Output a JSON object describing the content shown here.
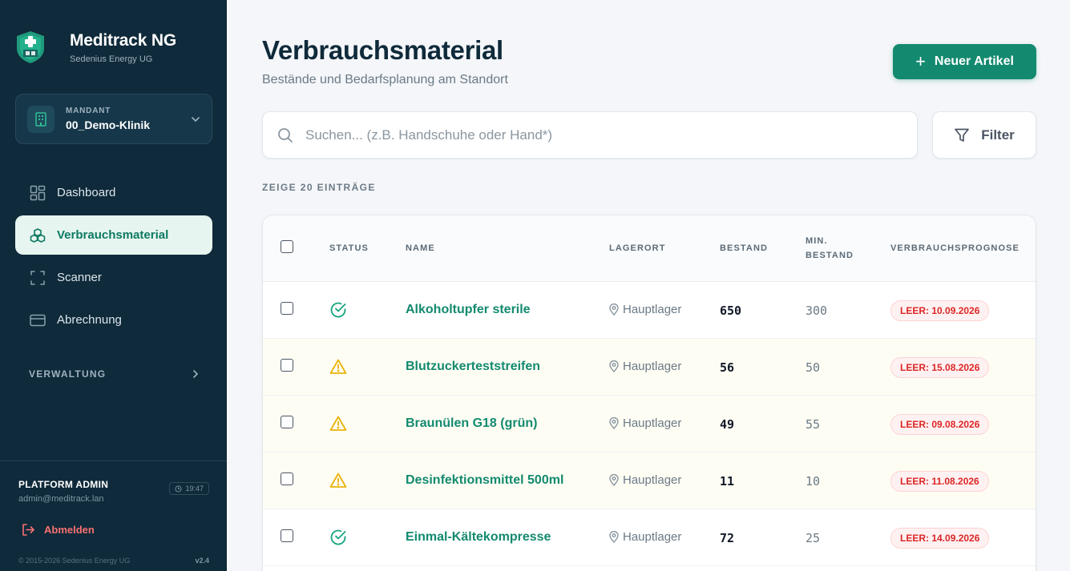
{
  "brand": {
    "title": "Meditrack NG",
    "subtitle": "Sedenius Energy UG"
  },
  "tenant": {
    "label": "MANDANT",
    "value": "00_Demo-Klinik"
  },
  "nav": {
    "items": [
      {
        "label": "Dashboard",
        "icon": "dashboard-icon"
      },
      {
        "label": "Verbrauchsmaterial",
        "icon": "cubes-icon"
      },
      {
        "label": "Scanner",
        "icon": "scan-icon"
      },
      {
        "label": "Abrechnung",
        "icon": "credit-card-icon"
      }
    ],
    "section_label": "VERWALTUNG"
  },
  "user": {
    "role": "PLATFORM ADMIN",
    "email": "admin@meditrack.lan",
    "time": "19:47"
  },
  "logout_label": "Abmelden",
  "footer": {
    "copyright": "© 2015-2026 Sedenius Energy UG",
    "version": "v2.4"
  },
  "page": {
    "title": "Verbrauchsmaterial",
    "subtitle": "Bestände und Bedarfsplanung am Standort"
  },
  "new_button_label": "Neuer Artikel",
  "search": {
    "placeholder": "Suchen... (z.B. Handschuhe oder Hand*)"
  },
  "filter_label": "Filter",
  "entry_count_label": "ZEIGE 20 EINTRÄGE",
  "table": {
    "headers": {
      "status": "STATUS",
      "name": "NAME",
      "location": "LAGERORT",
      "stock": "BESTAND",
      "min_stock_1": "MIN.",
      "min_stock_2": "BESTAND",
      "forecast": "VERBRAUCHSPROGNOSE"
    },
    "rows": [
      {
        "status": "ok",
        "name": "Alkoholtupfer sterile",
        "location": "Hauptlager",
        "stock": "650",
        "min": "300",
        "forecast": "LEER: 10.09.2026"
      },
      {
        "status": "warning",
        "name": "Blutzuckerteststreifen",
        "location": "Hauptlager",
        "stock": "56",
        "min": "50",
        "forecast": "LEER: 15.08.2026"
      },
      {
        "status": "warning",
        "name": "Braunülen G18 (grün)",
        "location": "Hauptlager",
        "stock": "49",
        "min": "55",
        "forecast": "LEER: 09.08.2026"
      },
      {
        "status": "warning",
        "name": "Desinfektionsmittel 500ml",
        "location": "Hauptlager",
        "stock": "11",
        "min": "10",
        "forecast": "LEER: 11.08.2026"
      },
      {
        "status": "ok",
        "name": "Einmal-Kältekompresse",
        "location": "Hauptlager",
        "stock": "72",
        "min": "25",
        "forecast": "LEER: 14.09.2026"
      }
    ]
  },
  "colors": {
    "accent": "#138a6f",
    "sidebar": "#0f2a3a",
    "warning": "#eab308",
    "danger": "#dc2626"
  }
}
